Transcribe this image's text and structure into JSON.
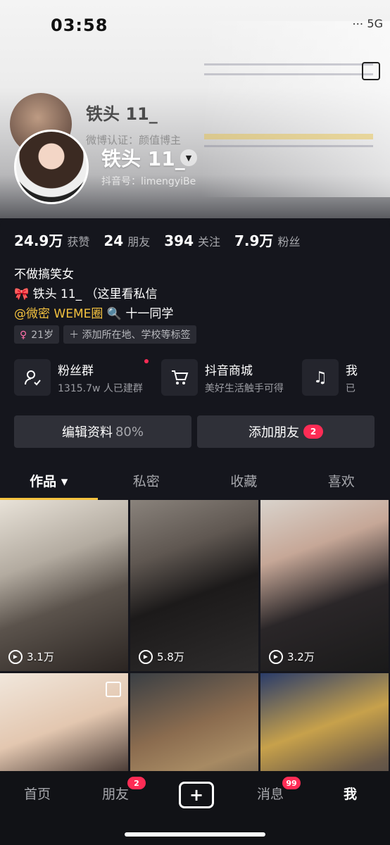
{
  "status": {
    "time": "03:58",
    "right": "⋯ 5G"
  },
  "header": {
    "ghost_name": "铁头 11_",
    "ghost_verified": "微博认证：颜值博主",
    "name": "铁头 11_",
    "douyin_id": "抖音号：limengyiBe"
  },
  "stats": [
    {
      "num": "24.9万",
      "label": "获赞"
    },
    {
      "num": "24",
      "label": "朋友"
    },
    {
      "num": "394",
      "label": "关注"
    },
    {
      "num": "7.9万",
      "label": "粉丝"
    }
  ],
  "bio": {
    "line1": "不做搞笑女",
    "line2": "铁头 11_ （这里看私信",
    "line3_mention": "@微密 WEME圈",
    "line3_rest": "十一同学"
  },
  "tags": {
    "age": "21岁",
    "add": "添加所在地、学校等标签"
  },
  "services": [
    {
      "icon": "fan-group-icon",
      "title": "粉丝群",
      "sub": "1315.7w 人已建群"
    },
    {
      "icon": "cart-icon",
      "title": "抖音商城",
      "sub": "美好生活触手可得"
    },
    {
      "icon": "music-icon",
      "title": "我",
      "sub": "已"
    }
  ],
  "actions": {
    "edit_label": "编辑资料",
    "edit_pct": "80%",
    "add_label": "添加朋友",
    "add_badge": "2"
  },
  "tabs": [
    {
      "label": "作品 ▾",
      "active": true
    },
    {
      "label": "私密"
    },
    {
      "label": "收藏"
    },
    {
      "label": "喜欢"
    }
  ],
  "grid": [
    {
      "views": "3.1万"
    },
    {
      "views": "5.8万"
    },
    {
      "views": "3.2万"
    },
    {
      "views": ""
    },
    {
      "views": ""
    },
    {
      "views": ""
    }
  ],
  "nav": {
    "home": "首页",
    "friends": "朋友",
    "friends_badge": "2",
    "plus": "+",
    "messages": "消息",
    "messages_badge": "99",
    "me": "我"
  },
  "colors": {
    "accent": "#f4c23f",
    "badge": "#fe2c55",
    "bg": "#15161d"
  }
}
